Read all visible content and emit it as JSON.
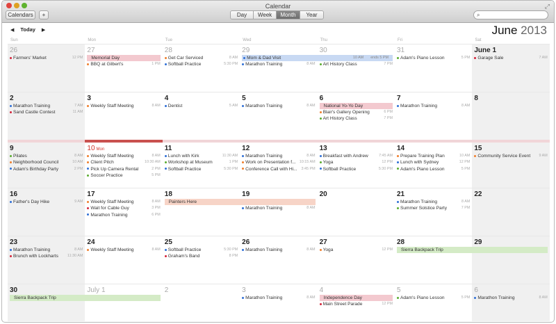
{
  "window": {
    "title": "Calendar"
  },
  "toolbar": {
    "calendars_label": "Calendars",
    "add_label": "+",
    "views": [
      "Day",
      "Week",
      "Month",
      "Year"
    ],
    "active_view": "Month",
    "search_placeholder": ""
  },
  "nav": {
    "prev": "◀",
    "today": "Today",
    "next": "▶"
  },
  "header": {
    "month": "June",
    "year": "2013"
  },
  "weekdays": [
    "Sun",
    "Mon",
    "Tue",
    "Wed",
    "Thu",
    "Fri",
    "Sat"
  ],
  "colors": {
    "blue": "#2f6fd6",
    "orange": "#f07f2c",
    "green": "#5aac2f",
    "red": "#d4243a",
    "bar_pink": "#f3c9cf",
    "bar_blue": "#c8d9f3",
    "bar_salmon": "#f7d4c7",
    "bar_green": "#d4ebc6",
    "today": "#d0342c"
  },
  "today": {
    "week": 2,
    "day": 1
  },
  "weeks": [
    {
      "days": [
        {
          "num": "26",
          "muted": true,
          "events": [
            {
              "title": "Farmers' Market",
              "time": "12 PM",
              "color": "red"
            }
          ]
        },
        {
          "num": "27",
          "muted": true,
          "events": [
            {
              "bar": "Memorial Day",
              "color": "bar_pink",
              "span": 1
            },
            {
              "title": "BBQ at Gilbert's",
              "time": "1 PM",
              "color": "orange"
            }
          ]
        },
        {
          "num": "28",
          "muted": true,
          "events": [
            {
              "title": "Get Car Serviced",
              "time": "8 AM",
              "color": "orange"
            },
            {
              "title": "Softball Practice",
              "time": "5:30 PM",
              "color": "blue"
            }
          ]
        },
        {
          "num": "29",
          "muted": true,
          "events": [
            {
              "bar": "Mom & Dad Visit",
              "color": "bar_blue",
              "span": 2,
              "time": "10 AM",
              "end": "ends 5 PM",
              "dot": "blue"
            },
            {
              "title": "Marathon Training",
              "time": "8 AM",
              "color": "blue"
            }
          ]
        },
        {
          "num": "30",
          "muted": true,
          "events": [
            {
              "continued": true
            },
            {
              "title": "Art History Class",
              "time": "7 PM",
              "color": "green"
            }
          ]
        },
        {
          "num": "31",
          "muted": true,
          "events": [
            {
              "title": "Adam's Piano Lesson",
              "time": "5 PM",
              "color": "green"
            }
          ]
        },
        {
          "num": "June 1",
          "events": [
            {
              "title": "Garage Sale",
              "time": "7 AM",
              "color": "red"
            }
          ]
        }
      ]
    },
    {
      "days": [
        {
          "num": "2",
          "events": [
            {
              "title": "Marathon Training",
              "time": "7 AM",
              "color": "blue"
            },
            {
              "title": "Sand Castle Contest",
              "time": "11 AM",
              "color": "red"
            }
          ]
        },
        {
          "num": "3",
          "events": [
            {
              "title": "Weekly Staff Meeting",
              "time": "8 AM",
              "color": "orange"
            }
          ]
        },
        {
          "num": "4",
          "events": [
            {
              "title": "Dentist",
              "time": "5 AM",
              "color": "blue"
            }
          ]
        },
        {
          "num": "5",
          "events": [
            {
              "title": "Marathon Training",
              "time": "8 AM",
              "color": "blue"
            }
          ]
        },
        {
          "num": "6",
          "events": [
            {
              "bar": "National Yo-Yo Day",
              "color": "bar_pink",
              "span": 1
            },
            {
              "title": "Blair's Gallery Opening",
              "time": "6 PM",
              "color": "orange"
            },
            {
              "title": "Art History Class",
              "time": "7 PM",
              "color": "green"
            }
          ]
        },
        {
          "num": "7",
          "events": [
            {
              "title": "Marathon Training",
              "time": "8 AM",
              "color": "blue"
            }
          ]
        },
        {
          "num": "8",
          "events": []
        }
      ]
    },
    {
      "days": [
        {
          "num": "9",
          "events": [
            {
              "title": "Pilates",
              "time": "8 AM",
              "color": "green"
            },
            {
              "title": "Neighborhood Council",
              "time": "10 AM",
              "color": "orange"
            },
            {
              "title": "Adam's Birthday Party",
              "time": "2 PM",
              "color": "blue"
            }
          ]
        },
        {
          "num": "10",
          "sub": "Mon",
          "events": [
            {
              "title": "Weekly Staff Meeting",
              "time": "8 AM",
              "color": "orange"
            },
            {
              "title": "Client Pitch",
              "time": "10:30 AM",
              "color": "orange"
            },
            {
              "title": "Pick Up Camera Rental",
              "time": "2 PM",
              "color": "blue"
            },
            {
              "title": "Soccer Practice",
              "time": "5 PM",
              "color": "green"
            }
          ]
        },
        {
          "num": "11",
          "events": [
            {
              "title": "Lunch with Kirk",
              "time": "11:30 AM",
              "color": "blue"
            },
            {
              "title": "Workshop at Museum",
              "time": "1 PM",
              "color": "green"
            },
            {
              "title": "Softball Practice",
              "time": "5:30 PM",
              "color": "blue"
            }
          ]
        },
        {
          "num": "12",
          "events": [
            {
              "title": "Marathon Training",
              "time": "8 AM",
              "color": "blue"
            },
            {
              "title": "Work on Presentation f...",
              "time": "10:15 AM",
              "color": "orange"
            },
            {
              "title": "Conference Call with Hi...",
              "time": "3:45 PM",
              "color": "orange"
            }
          ]
        },
        {
          "num": "13",
          "events": [
            {
              "title": "Breakfast with Andrew",
              "time": "7:45 AM",
              "color": "blue"
            },
            {
              "title": "Yoga",
              "time": "12 PM",
              "color": "green"
            },
            {
              "title": "Softball Practice",
              "time": "5:30 PM",
              "color": "blue"
            }
          ]
        },
        {
          "num": "14",
          "events": [
            {
              "title": "Prepare Training Plan",
              "time": "10 AM",
              "color": "orange"
            },
            {
              "title": "Lunch with Sydney",
              "time": "12 PM",
              "color": "blue"
            },
            {
              "title": "Adam's Piano Lesson",
              "time": "5 PM",
              "color": "green"
            }
          ]
        },
        {
          "num": "15",
          "events": [
            {
              "title": "Community Service Event",
              "time": "9 AM",
              "color": "orange"
            }
          ]
        }
      ]
    },
    {
      "days": [
        {
          "num": "16",
          "events": [
            {
              "title": "Father's Day Hike",
              "time": "9 AM",
              "color": "blue"
            }
          ]
        },
        {
          "num": "17",
          "events": [
            {
              "title": "Weekly Staff Meeting",
              "time": "8 AM",
              "color": "orange"
            },
            {
              "title": "Wait for Cable Guy",
              "time": "3 PM",
              "color": "red"
            },
            {
              "title": "Marathon Training",
              "time": "6 PM",
              "color": "blue"
            }
          ]
        },
        {
          "num": "18",
          "events": [
            {
              "bar": "Painters Here",
              "color": "bar_salmon",
              "span": 2
            }
          ]
        },
        {
          "num": "19",
          "events": [
            {
              "continued": true
            },
            {
              "title": "Marathon Training",
              "time": "8 AM",
              "color": "blue"
            }
          ]
        },
        {
          "num": "20",
          "events": []
        },
        {
          "num": "21",
          "events": [
            {
              "title": "Marathon Training",
              "time": "8 AM",
              "color": "blue"
            },
            {
              "title": "Summer Solstice Party",
              "time": "7 PM",
              "color": "green"
            }
          ]
        },
        {
          "num": "22",
          "events": []
        }
      ]
    },
    {
      "days": [
        {
          "num": "23",
          "events": [
            {
              "title": "Marathon Training",
              "time": "8 AM",
              "color": "blue"
            },
            {
              "title": "Brunch with Lockharts",
              "time": "11:30 AM",
              "color": "red"
            }
          ]
        },
        {
          "num": "24",
          "events": [
            {
              "title": "Weekly Staff Meeting",
              "time": "8 AM",
              "color": "orange"
            }
          ]
        },
        {
          "num": "25",
          "events": [
            {
              "title": "Softball Practice",
              "time": "5:30 PM",
              "color": "blue"
            },
            {
              "title": "Graham's Band",
              "time": "8 PM",
              "color": "red"
            }
          ]
        },
        {
          "num": "26",
          "events": [
            {
              "title": "Marathon Training",
              "time": "8 AM",
              "color": "blue"
            }
          ]
        },
        {
          "num": "27",
          "events": [
            {
              "title": "Yoga",
              "time": "12 PM",
              "color": "orange"
            }
          ]
        },
        {
          "num": "28",
          "events": [
            {
              "bar": "Sierra Backpack Trip",
              "color": "bar_green",
              "span": 2
            }
          ]
        },
        {
          "num": "29",
          "events": [
            {
              "continued": true
            }
          ]
        }
      ]
    },
    {
      "days": [
        {
          "num": "30",
          "events": [
            {
              "bar": "Sierra Backpack Trip",
              "color": "bar_green",
              "span": 2
            }
          ]
        },
        {
          "num": "July 1",
          "muted": true,
          "events": [
            {
              "continued": true
            }
          ]
        },
        {
          "num": "2",
          "muted": true,
          "events": []
        },
        {
          "num": "3",
          "muted": true,
          "events": [
            {
              "title": "Marathon Training",
              "time": "8 AM",
              "color": "blue"
            }
          ]
        },
        {
          "num": "4",
          "muted": true,
          "events": [
            {
              "bar": "Independence Day",
              "color": "bar_pink",
              "span": 1
            },
            {
              "title": "Main Street Parade",
              "time": "12 PM",
              "color": "red"
            }
          ]
        },
        {
          "num": "5",
          "muted": true,
          "events": [
            {
              "title": "Adam's Piano Lesson",
              "time": "5 PM",
              "color": "green"
            }
          ]
        },
        {
          "num": "6",
          "muted": true,
          "events": [
            {
              "title": "Marathon Training",
              "time": "8 AM",
              "color": "blue"
            }
          ]
        }
      ]
    }
  ]
}
